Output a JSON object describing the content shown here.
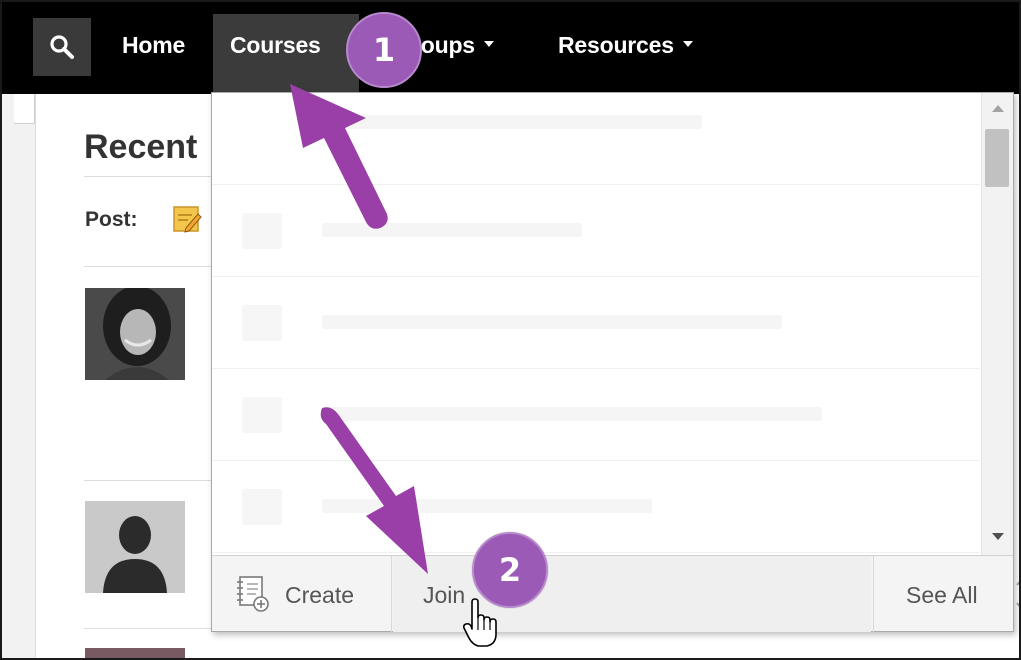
{
  "nav": {
    "items": [
      {
        "label": "Home",
        "has_caret": false
      },
      {
        "label": "Courses",
        "has_caret": false,
        "active": true
      },
      {
        "label": "roups",
        "has_caret": true
      },
      {
        "label": "Resources",
        "has_caret": true
      }
    ],
    "search_icon": "search-icon"
  },
  "page": {
    "recent_title": "Recent",
    "post_label": "Post:"
  },
  "dropdown": {
    "footer": {
      "create_label": "Create",
      "join_label": "Join",
      "see_all_label": "See All"
    }
  },
  "annotations": {
    "step1": "1",
    "step2": "2"
  },
  "colors": {
    "nav_bg": "#000000",
    "active_nav_bg": "#3b3b3b",
    "callout": "#9a5ab6",
    "arrow": "#9b3fa8"
  }
}
